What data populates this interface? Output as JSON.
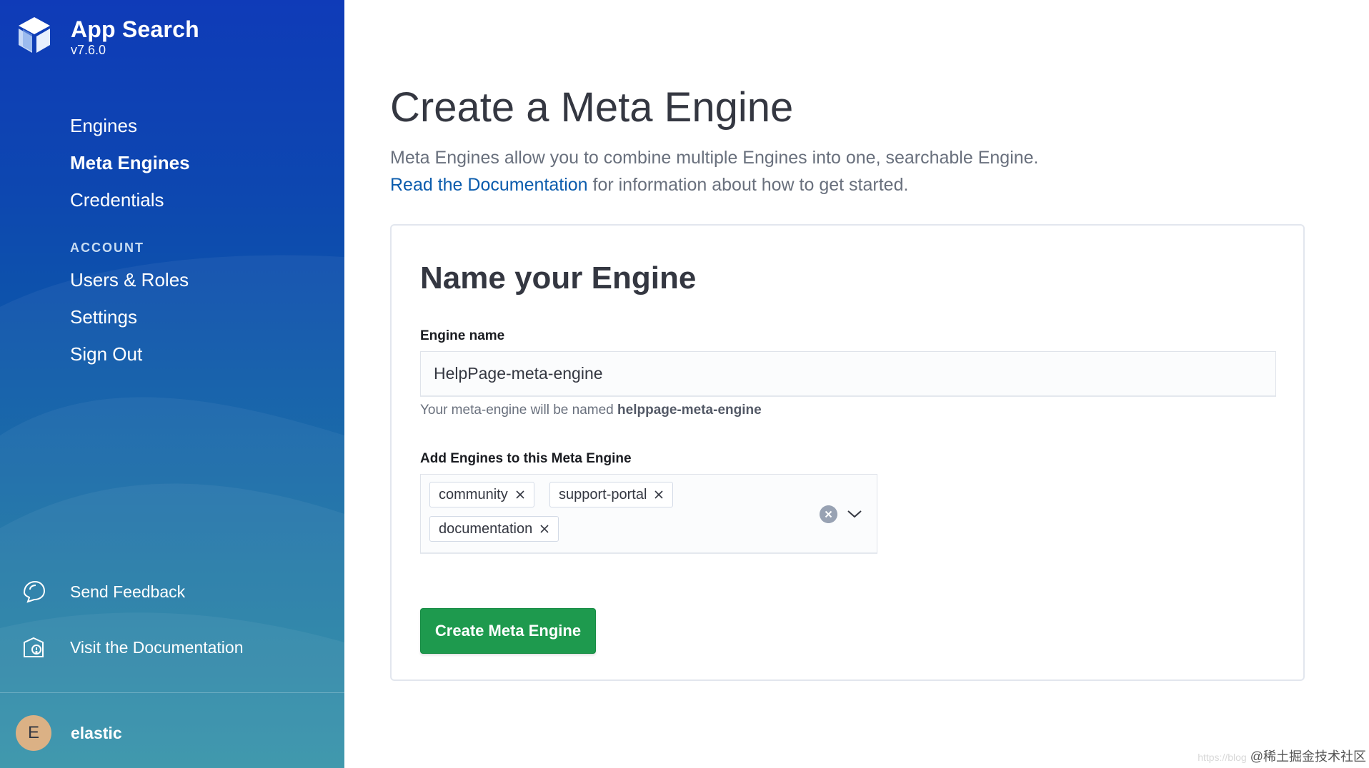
{
  "app": {
    "title": "App Search",
    "version": "v7.6.0"
  },
  "nav": {
    "items": [
      {
        "label": "Engines"
      },
      {
        "label": "Meta Engines"
      },
      {
        "label": "Credentials"
      }
    ],
    "account_heading": "ACCOUNT",
    "account_items": [
      {
        "label": "Users & Roles"
      },
      {
        "label": "Settings"
      },
      {
        "label": "Sign Out"
      }
    ],
    "feedback_label": "Send Feedback",
    "docs_label": "Visit the Documentation"
  },
  "user": {
    "initial": "E",
    "name": "elastic"
  },
  "page": {
    "title": "Create a Meta Engine",
    "desc_line1": "Meta Engines allow you to combine multiple Engines into one, searchable Engine.",
    "doc_link": "Read the Documentation",
    "desc_line2_rest": " for information about how to get started."
  },
  "form": {
    "panel_title": "Name your Engine",
    "engine_name_label": "Engine name",
    "engine_name_value": "HelpPage-meta-engine",
    "help_prefix": "Your meta-engine will be named ",
    "help_name": "helppage-meta-engine",
    "engines_label": "Add Engines to this Meta Engine",
    "selected_engines": [
      "community",
      "support-portal",
      "documentation"
    ],
    "submit_label": "Create Meta Engine"
  },
  "watermark": {
    "faint": "https://blog",
    "text": "@稀土掘金技术社区"
  },
  "colors": {
    "sidebar_top": "#0f3bb8",
    "sidebar_bottom": "#17839c",
    "link": "#0b5cad",
    "primary_button": "#1e9a4e"
  },
  "icons": {
    "logo": "app-search-logo",
    "feedback": "feedback-icon",
    "docs": "documentation-icon",
    "pill_remove": "cross-icon",
    "clear": "clear-icon",
    "dropdown": "chevron-down-icon"
  }
}
